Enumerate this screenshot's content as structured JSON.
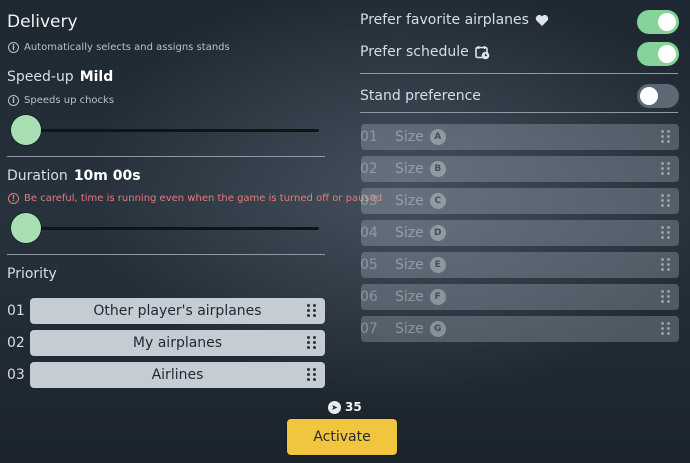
{
  "colors": {
    "toggle_on": "#86d39a",
    "toggle_off": "#5c6874",
    "slider_knob": "#a8e0b4",
    "warning": "#e87a7a",
    "activate_button": "#f1c63f"
  },
  "delivery": {
    "title": "Delivery",
    "hint": "Automatically selects and assigns stands",
    "hint_icon": "info-icon"
  },
  "speed_up": {
    "label": "Speed-up",
    "value": "Mild",
    "hint": "Speeds up chocks",
    "hint_icon": "info-icon",
    "slider_level": 0
  },
  "duration": {
    "label": "Duration",
    "value": "10m 00s",
    "warning": "Be careful, time is running even when the game is turned off or paused",
    "warning_icon": "alert-icon",
    "slider_level": 0
  },
  "priority": {
    "label": "Priority",
    "items": [
      {
        "num": "01",
        "label": "Other player's airplanes"
      },
      {
        "num": "02",
        "label": "My airplanes"
      },
      {
        "num": "03",
        "label": "Airlines"
      }
    ]
  },
  "toggles": {
    "prefer_favorite": {
      "label": "Prefer favorite airplanes",
      "icon": "heart-icon",
      "on": true
    },
    "prefer_schedule": {
      "label": "Prefer schedule",
      "icon": "calendar-clock-icon",
      "on": true
    },
    "stand_preference": {
      "label": "Stand preference",
      "on": false
    }
  },
  "stands": [
    {
      "num": "01",
      "label": "Size",
      "letter": "A"
    },
    {
      "num": "02",
      "label": "Size",
      "letter": "B"
    },
    {
      "num": "03",
      "label": "Size",
      "letter": "C"
    },
    {
      "num": "04",
      "label": "Size",
      "letter": "D"
    },
    {
      "num": "05",
      "label": "Size",
      "letter": "E"
    },
    {
      "num": "06",
      "label": "Size",
      "letter": "F"
    },
    {
      "num": "07",
      "label": "Size",
      "letter": "G"
    }
  ],
  "cost": {
    "icon": "coin-icon",
    "value": "35"
  },
  "activate": {
    "label": "Activate"
  }
}
